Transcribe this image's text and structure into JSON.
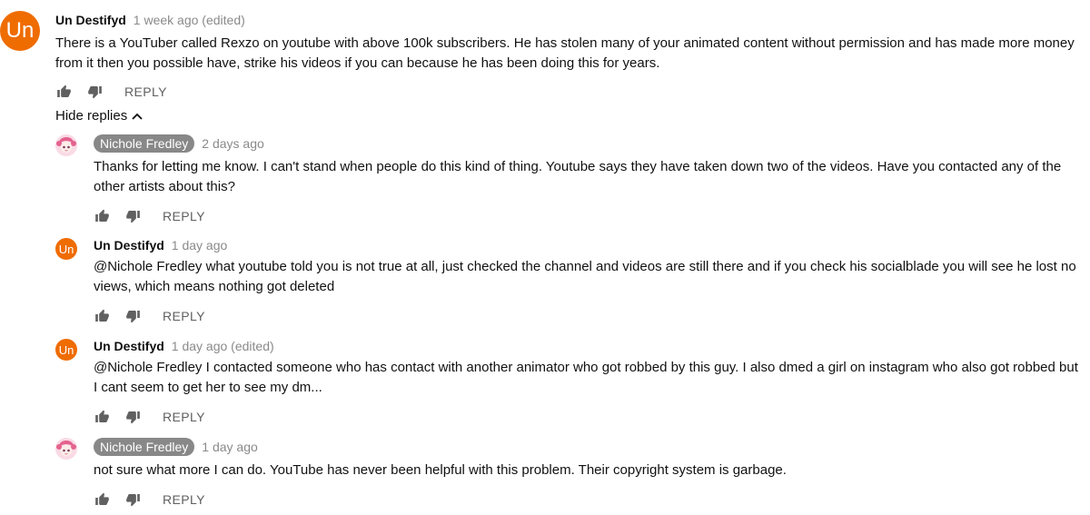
{
  "top_comment": {
    "avatar_text": "Un",
    "author": "Un Destifyd",
    "time": "1 week ago (edited)",
    "text": "There is a YouTuber called Rexzo on youtube with above 100k subscribers. He has stolen many of your animated content without permission and has made more money from it then you possible have, strike his videos if you can because he has been doing this for years.",
    "reply_label": "REPLY"
  },
  "hide_replies_label": "Hide replies",
  "replies": [
    {
      "author": "Nichole Fredley",
      "time": "2 days ago",
      "text": "Thanks for letting me know. I can't stand when people do this kind of thing. Youtube says they have taken down two of the videos. Have you contacted any of the other artists about this?",
      "reply_label": "REPLY"
    },
    {
      "avatar_text": "Un",
      "author": "Un Destifyd",
      "time": "1 day ago",
      "text": "@Nichole Fredley what youtube told you is not true at all, just checked the channel and videos are still there and if you check his socialblade you will see he lost no views, which means nothing got deleted",
      "reply_label": "REPLY"
    },
    {
      "avatar_text": "Un",
      "author": "Un Destifyd",
      "time": "1 day ago (edited)",
      "text": "@Nichole Fredley I contacted someone who has contact with another animator who got robbed by this guy. I also dmed a girl on instagram who also got robbed but I cant seem to get her to see my dm...",
      "reply_label": "REPLY"
    },
    {
      "author": "Nichole Fredley",
      "time": "1 day ago",
      "text": "not sure what more I can do. YouTube has never been helpful with this problem. Their copyright system is garbage.",
      "reply_label": "REPLY"
    }
  ],
  "icons": {
    "like": "thumbs-up-icon",
    "dislike": "thumbs-down-icon",
    "chevron": "chevron-up-icon"
  },
  "colors": {
    "avatar_orange": "#ef6c00",
    "pill_gray": "#888888",
    "meta_gray": "#8a8a8a"
  }
}
